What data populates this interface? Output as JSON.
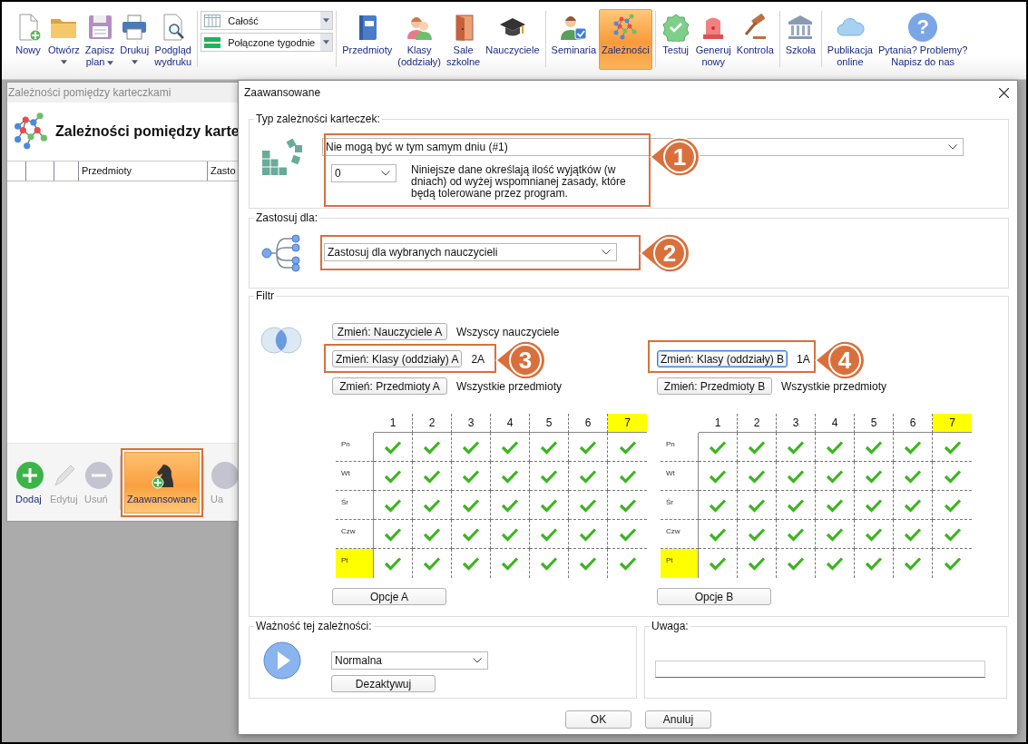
{
  "toolbar": {
    "groups": [
      {
        "kind": "buttons",
        "items": [
          {
            "label": "Nowy",
            "has_menu": false,
            "selected": false
          },
          {
            "label": "Otwórz",
            "has_menu": true,
            "selected": false
          },
          {
            "label": "Zapisz\nplan",
            "has_menu": true,
            "selected": false
          },
          {
            "label": "Drukuj",
            "has_menu": true,
            "selected": false
          },
          {
            "label": "Podgląd\nwydruku",
            "has_menu": false,
            "selected": false
          }
        ]
      },
      {
        "kind": "selectors",
        "items": [
          {
            "value": "Całość"
          },
          {
            "value": "Połączone tygodnie"
          }
        ]
      },
      {
        "kind": "buttons",
        "items": [
          {
            "label": "Przedmioty",
            "has_menu": false,
            "selected": false
          },
          {
            "label": "Klasy\n(oddziały)",
            "has_menu": false,
            "selected": false
          },
          {
            "label": "Sale\nszkolne",
            "has_menu": false,
            "selected": false
          },
          {
            "label": "Nauczyciele",
            "has_menu": false,
            "selected": false
          }
        ]
      },
      {
        "kind": "buttons",
        "items": [
          {
            "label": "Seminaria",
            "has_menu": false,
            "selected": false
          },
          {
            "label": "Zależności",
            "has_menu": false,
            "selected": true
          }
        ]
      },
      {
        "kind": "buttons",
        "items": [
          {
            "label": "Testuj",
            "has_menu": false,
            "selected": false
          },
          {
            "label": "Generuj\nnowy",
            "has_menu": false,
            "selected": false
          },
          {
            "label": "Kontrola",
            "has_menu": false,
            "selected": false
          }
        ]
      },
      {
        "kind": "buttons",
        "items": [
          {
            "label": "Szkoła",
            "has_menu": false,
            "selected": false
          }
        ]
      },
      {
        "kind": "buttons",
        "items": [
          {
            "label": "Publikacja\nonline",
            "has_menu": false,
            "selected": false
          },
          {
            "label": "Pytania? Problemy?\nNapisz do nas",
            "has_menu": false,
            "selected": false,
            "glyph": "?"
          }
        ]
      }
    ]
  },
  "panel": {
    "title": "Zależności pomiędzy karteczkami",
    "heading": "Zależności pomiędzy karte",
    "columns": [
      "Przedmioty",
      "Zasto"
    ],
    "actions": [
      {
        "label": "Dodaj",
        "disabled": false,
        "selected": false
      },
      {
        "label": "Edytuj",
        "disabled": true,
        "selected": false
      },
      {
        "label": "Usuń",
        "disabled": true,
        "selected": false
      },
      {
        "label": "Zaawansowane",
        "disabled": false,
        "selected": true
      },
      {
        "label": "Ua",
        "disabled": true,
        "selected": false
      }
    ]
  },
  "dialog": {
    "title": "Zaawansowane",
    "type_section": {
      "legend": "Typ zależności karteczek:",
      "rule": "Nie mogą być w tym samym dniu (#1)",
      "exceptions": "0",
      "note": "Niniejsze dane określają ilość wyjątków (w dniach) od wyżej wspomnianej zasady, które będą tolerowane przez program."
    },
    "apply_section": {
      "legend": "Zastosuj dla:",
      "value": "Zastosuj dla wybranych nauczycieli"
    },
    "filter": {
      "legend": "Filtr",
      "sides": [
        {
          "rows": [
            {
              "button": "Zmień: Nauczyciele A",
              "value": "Wszyscy nauczyciele",
              "focused": false
            },
            {
              "button": "Zmień: Klasy (oddziały) A",
              "value": "2A",
              "focused": false
            },
            {
              "button": "Zmień: Przedmioty A",
              "value": "Wszystkie przedmioty",
              "focused": false
            }
          ],
          "grid": {
            "columns": [
              {
                "label": "1",
                "highlighted": false
              },
              {
                "label": "2",
                "highlighted": false
              },
              {
                "label": "3",
                "highlighted": false
              },
              {
                "label": "4",
                "highlighted": false
              },
              {
                "label": "5",
                "highlighted": false
              },
              {
                "label": "6",
                "highlighted": false
              },
              {
                "label": "7",
                "highlighted": true
              }
            ],
            "rows": [
              {
                "label": "Pn",
                "highlighted": false,
                "checks": [
                  true,
                  true,
                  true,
                  true,
                  true,
                  true,
                  true
                ]
              },
              {
                "label": "Wt",
                "highlighted": false,
                "checks": [
                  true,
                  true,
                  true,
                  true,
                  true,
                  true,
                  true
                ]
              },
              {
                "label": "Śr",
                "highlighted": false,
                "checks": [
                  true,
                  true,
                  true,
                  true,
                  true,
                  true,
                  true
                ]
              },
              {
                "label": "Czw",
                "highlighted": false,
                "checks": [
                  true,
                  true,
                  true,
                  true,
                  true,
                  true,
                  true
                ]
              },
              {
                "label": "Pt",
                "highlighted": true,
                "checks": [
                  true,
                  true,
                  true,
                  true,
                  true,
                  true,
                  true
                ]
              }
            ]
          },
          "options_button": "Opcje A"
        },
        {
          "rows": [
            {
              "button": "Zmień: Klasy (oddziały) B",
              "value": "1A",
              "focused": true
            },
            {
              "button": "Zmień: Przedmioty B",
              "value": "Wszystkie przedmioty",
              "focused": false
            }
          ],
          "grid": {
            "columns": [
              {
                "label": "1",
                "highlighted": false
              },
              {
                "label": "2",
                "highlighted": false
              },
              {
                "label": "3",
                "highlighted": false
              },
              {
                "label": "4",
                "highlighted": false
              },
              {
                "label": "5",
                "highlighted": false
              },
              {
                "label": "6",
                "highlighted": false
              },
              {
                "label": "7",
                "highlighted": true
              }
            ],
            "rows": [
              {
                "label": "Pn",
                "highlighted": false,
                "checks": [
                  true,
                  true,
                  true,
                  true,
                  true,
                  true,
                  true
                ]
              },
              {
                "label": "Wt",
                "highlighted": false,
                "checks": [
                  true,
                  true,
                  true,
                  true,
                  true,
                  true,
                  true
                ]
              },
              {
                "label": "Śr",
                "highlighted": false,
                "checks": [
                  true,
                  true,
                  true,
                  true,
                  true,
                  true,
                  true
                ]
              },
              {
                "label": "Czw",
                "highlighted": false,
                "checks": [
                  true,
                  true,
                  true,
                  true,
                  true,
                  true,
                  true
                ]
              },
              {
                "label": "Pt",
                "highlighted": true,
                "checks": [
                  true,
                  true,
                  true,
                  true,
                  true,
                  true,
                  true
                ]
              }
            ]
          },
          "options_button": "Opcje B"
        }
      ]
    },
    "severity": {
      "legend": "Ważność tej zależności:",
      "value": "Normalna",
      "button": "Dezaktywuj"
    },
    "remark": {
      "legend": "Uwaga:"
    },
    "buttons": [
      "OK",
      "Anuluj"
    ],
    "callouts": [
      {
        "number": "1"
      },
      {
        "number": "2"
      },
      {
        "number": "3"
      },
      {
        "number": "4"
      }
    ]
  }
}
